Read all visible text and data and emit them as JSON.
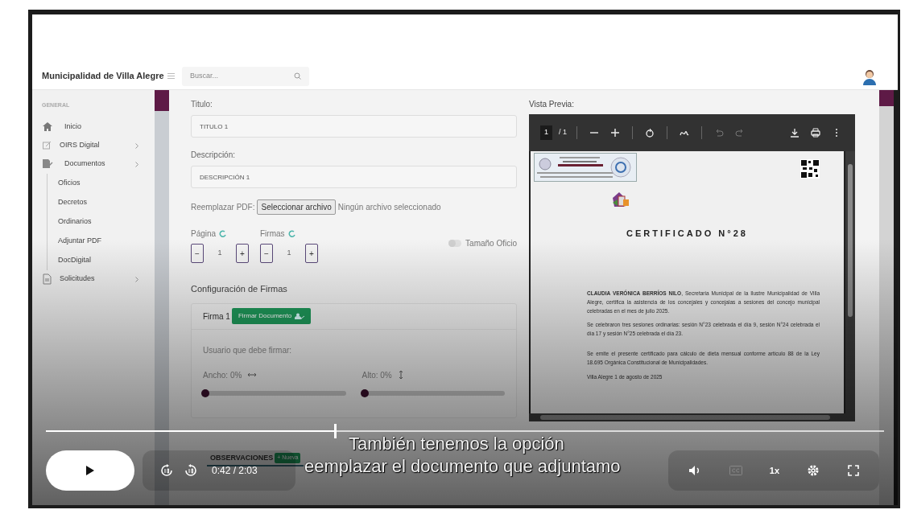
{
  "app": {
    "header": {
      "title": "Municipalidad de Villa Alegre",
      "search": {
        "placeholder": "Buscar..."
      }
    },
    "sidebar": {
      "section": "GENERAL",
      "items": [
        {
          "label": "Inicio",
          "kind": "link"
        },
        {
          "label": "OIRS Digital",
          "kind": "group",
          "expanded": false
        },
        {
          "label": "Documentos",
          "kind": "group",
          "expanded": true,
          "children": [
            {
              "label": "Oficios"
            },
            {
              "label": "Decretos"
            },
            {
              "label": "Ordinarios"
            },
            {
              "label": "Adjuntar PDF"
            },
            {
              "label": "DocDigital"
            }
          ]
        },
        {
          "label": "Solicitudes",
          "kind": "group",
          "expanded": false
        }
      ]
    },
    "form": {
      "fields": [
        {
          "label": "Titulo:",
          "value": "TITULO 1"
        },
        {
          "label": "Descripción:",
          "value": "DESCRIPCIÓN 1"
        }
      ],
      "replace_pdf": {
        "label": "Reemplazar PDF:",
        "button": "Seleccionar archivo",
        "status": "Ningún archivo seleccionado"
      },
      "steppers": [
        {
          "label": "Página",
          "value": "1",
          "minus": "−",
          "plus": "+"
        },
        {
          "label": "Firmas",
          "value": "1",
          "minus": "−",
          "plus": "+"
        }
      ],
      "toggle": {
        "label": "Tamaño Oficio",
        "on": false
      },
      "signatures": {
        "title": "Configuración de Firmas",
        "card_title": "Firma 1",
        "sign_button": "Firmar Documento",
        "user_label": "Usuario que debe firmar:",
        "sliders": [
          {
            "label": "Ancho: 0%",
            "level": 0
          },
          {
            "label": "Alto: 0%",
            "level": 0
          }
        ]
      },
      "tabs": [
        {
          "label": "OBSERVACIONES",
          "badge": "+ Nueva",
          "selected": true
        }
      ]
    },
    "preview": {
      "label": "Vista Previa:",
      "toolbar": {
        "page": "1",
        "total": "/ 1",
        "buttons": [
          {
            "kind": "zoom-out",
            "disabled": false
          },
          {
            "kind": "zoom-in",
            "disabled": false
          },
          {
            "kind": "rotate",
            "disabled": false
          },
          {
            "kind": "draw",
            "disabled": false
          },
          {
            "kind": "undo",
            "disabled": true
          },
          {
            "kind": "redo",
            "disabled": true
          },
          {
            "kind": "download",
            "disabled": false
          },
          {
            "kind": "print",
            "disabled": false
          },
          {
            "kind": "more",
            "disabled": false
          }
        ]
      },
      "document": {
        "title": "CERTIFICADO N°28",
        "paragraphs": [
          "**CLAUDIA VERÓNICA BERRÍOS NILO**, Secretaria Municipal de la Ilustre Municipalidad de Villa Alegre, certifica la asistencia de los concejales y concejalas a sesiones del concejo municipal celebradas en el mes de julio 2025.",
          "Se celebraron tres sesiones ordinarias: sesión N°23 celebrada el día 9, sesión N°24 celebrada el día 17 y sesión N°25 celebrada el día 23.",
          "Se emite el presente certificado para cálculo de dieta mensual conforme artículo 88 de la Ley 18.695 Orgánica Constitucional de Municipalidades."
        ],
        "date": "Villa Alegre 1 de agosto de 2025"
      }
    }
  },
  "captions": [
    "También tenemos la opción",
    "eemplazar el documento que adjuntamo"
  ],
  "player": {
    "progress": {
      "level": 0.344
    },
    "time": "0:42 / 2:03",
    "speed": "1x",
    "captions_available": false
  }
}
